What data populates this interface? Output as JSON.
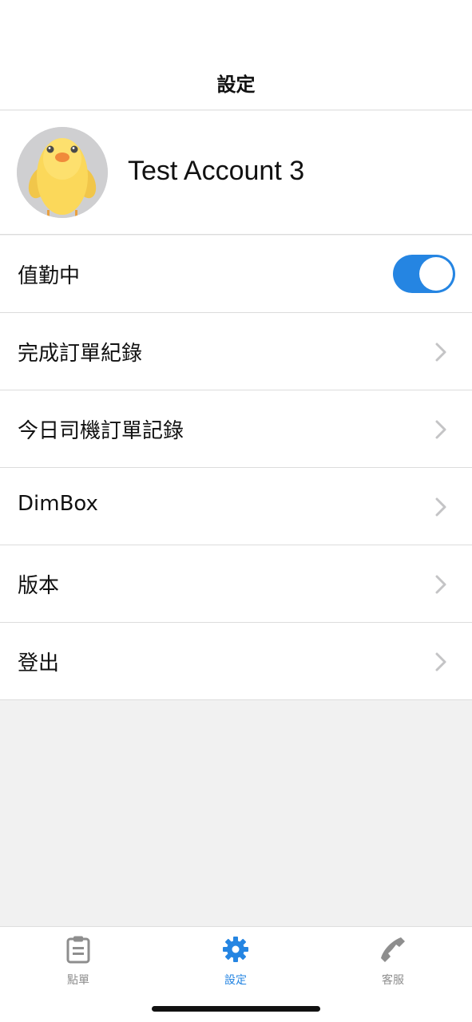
{
  "header": {
    "title": "設定"
  },
  "profile": {
    "name": "Test Account 3",
    "avatar_icon": "chick-avatar"
  },
  "menu": {
    "on_duty": {
      "label": "值勤中",
      "toggle_on": true
    },
    "items": [
      {
        "label": "完成訂單紀錄",
        "icon": "chevron-right-icon"
      },
      {
        "label": "今日司機訂單記錄",
        "icon": "chevron-right-icon"
      },
      {
        "label": "DimBox",
        "icon": "chevron-right-icon"
      },
      {
        "label": "版本",
        "icon": "chevron-right-icon"
      },
      {
        "label": "登出",
        "icon": "chevron-right-icon"
      }
    ]
  },
  "tabbar": {
    "tabs": [
      {
        "label": "點單",
        "icon": "clipboard-icon",
        "active": false
      },
      {
        "label": "設定",
        "icon": "gear-icon",
        "active": true
      },
      {
        "label": "客服",
        "icon": "phone-icon",
        "active": false
      }
    ]
  },
  "colors": {
    "accent": "#2585e2",
    "inactive": "#8e8e8e",
    "toggle_on": "#2585e2"
  }
}
